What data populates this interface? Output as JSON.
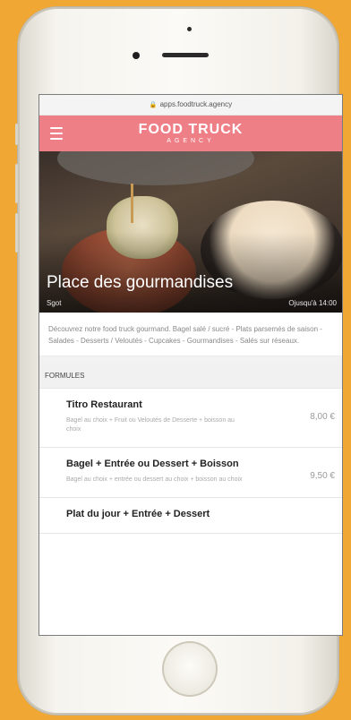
{
  "browser": {
    "url": "apps.foodtruck.agency"
  },
  "header": {
    "logo_line1": "FOOD TRUCK",
    "logo_line2": "AGENCY"
  },
  "hero": {
    "title": "Place des gourmandises",
    "city": "Sgot",
    "time": "Ojusqu'à 14:00"
  },
  "description": "Découvrez notre food truck gourmand. Bagel salé / sucré - Plats parsemés de saison - Salades - Desserts / Veloutés - Cupcakes - Gourmandises - Salés sur réseaux.",
  "section": {
    "title": "FORMULES"
  },
  "items": [
    {
      "name": "Titro Restaurant",
      "desc": "Bagel au choix + Fruit ou Veloutés de Desserte + boisson au choix",
      "price": "8,00 €"
    },
    {
      "name": "Bagel + Entrée ou Dessert + Boisson",
      "desc": "Bagel au choix + entrée ou dessert au choix + boisson au choix",
      "price": "9,50 €"
    },
    {
      "name": "Plat du jour + Entrée + Dessert",
      "desc": "",
      "price": ""
    }
  ],
  "colors": {
    "accent": "#ef7f86",
    "background": "#f0a734"
  }
}
